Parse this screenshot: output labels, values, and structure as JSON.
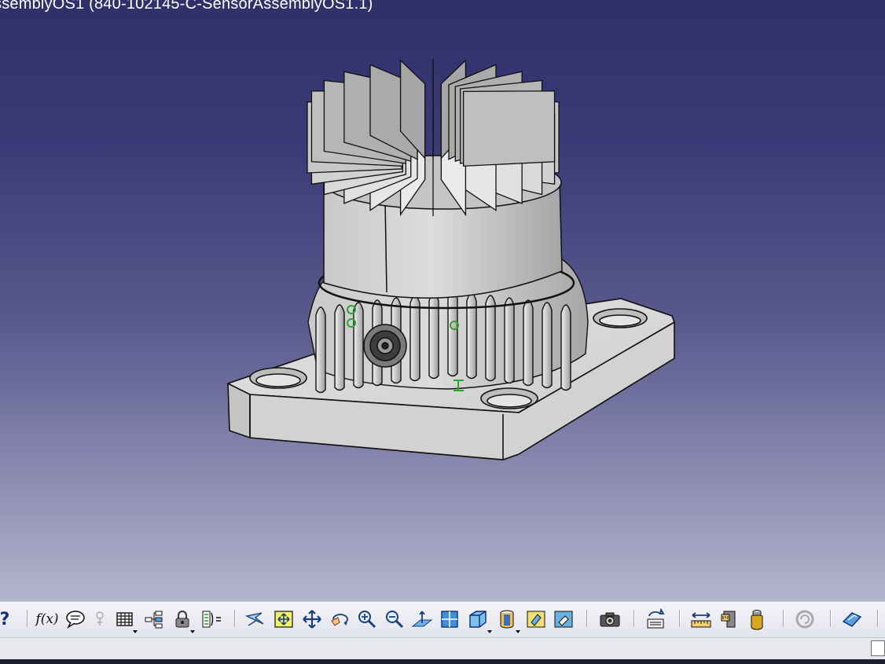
{
  "window": {
    "title": "ssemblyOS1 (840-102145-C-SensorAssemblyOS1.1)"
  },
  "viewport": {
    "background_top": "#2f2f6a",
    "background_bottom": "#b4b4cc",
    "model_name": "SensorAssemblyOS1"
  },
  "toolbar": {
    "icons": [
      {
        "name": "help-icon",
        "glyph": "?"
      },
      {
        "name": "formula-icon",
        "glyph": "f(x)"
      },
      {
        "name": "comment-icon"
      },
      {
        "name": "knowledge-icon"
      },
      {
        "name": "table-icon"
      },
      {
        "name": "tree-icon"
      },
      {
        "name": "lock-icon"
      },
      {
        "name": "parameters-icon"
      },
      {
        "name": "fly-mode-icon"
      },
      {
        "name": "fit-all-icon"
      },
      {
        "name": "pan-icon"
      },
      {
        "name": "rotate-icon"
      },
      {
        "name": "zoom-in-icon"
      },
      {
        "name": "zoom-out-icon"
      },
      {
        "name": "normal-view-icon"
      },
      {
        "name": "multi-view-icon"
      },
      {
        "name": "iso-view-icon"
      },
      {
        "name": "shading-icon"
      },
      {
        "name": "hide-show-icon"
      },
      {
        "name": "swap-visible-icon"
      },
      {
        "name": "capture-icon"
      },
      {
        "name": "update-icon"
      },
      {
        "name": "measure-icon"
      },
      {
        "name": "measure-inertia-icon"
      },
      {
        "name": "material-icon"
      },
      {
        "name": "refresh-icon"
      },
      {
        "name": "sketch-icon"
      }
    ],
    "help_glyph": "?",
    "formula_glyph": "f(x)"
  },
  "statusbar": {
    "command_input_value": ""
  }
}
